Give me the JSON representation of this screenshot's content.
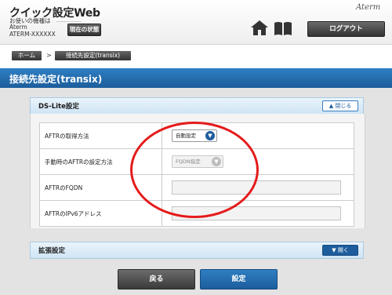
{
  "header": {
    "title": "クイック設定Web",
    "info_label": "お使いの機種は",
    "model_line1": "Aterm",
    "model_line2": "ATERM-XXXXXX",
    "status_button": "現在の状態",
    "brand": "Aterm",
    "logout_button": "ログアウト"
  },
  "breadcrumb": {
    "home": "ホーム",
    "separator": ">",
    "current": "接続先設定(transix)"
  },
  "page_title": "接続先設定(transix)",
  "sections": {
    "ds_lite": {
      "title": "DS-Lite設定",
      "toggle": "閉じる",
      "rows": {
        "aftr_method": {
          "label": "AFTRの取得方法",
          "value": "自動設定"
        },
        "manual_method": {
          "label": "手動時のAFTRの設定方法",
          "value": "FQDN指定"
        },
        "aftr_fqdn": {
          "label": "AFTRのFQDN",
          "value": ""
        },
        "aftr_ipv6": {
          "label": "AFTRのIPv6アドレス",
          "value": ""
        }
      }
    },
    "extended": {
      "title": "拡張設定",
      "toggle": "開く"
    }
  },
  "actions": {
    "back": "戻る",
    "save": "設定"
  },
  "colors": {
    "accent_blue": "#1d5d9c",
    "annotation_red": "#e51b1b"
  }
}
